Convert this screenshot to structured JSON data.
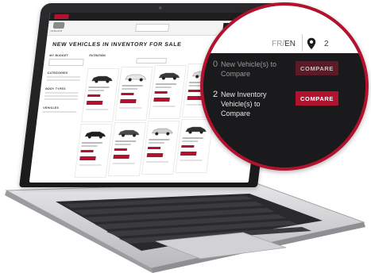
{
  "website": {
    "brand": "JAGUAR",
    "page_title": "NEW VEHICLES IN INVENTORY FOR SALE",
    "sidebar": {
      "budget_label": "MY BUDGET",
      "categories_label": "CATEGORIES",
      "body_types_label": "BODY TYPES",
      "vehicles_label": "VEHICLES"
    },
    "filter_label": "FILTRATION",
    "cards": [
      {
        "name": "2021 JAGUAR F-PACE",
        "price": "$72,970"
      },
      {
        "name": "2021 JAGUAR F-PACE",
        "price": "$67,605"
      },
      {
        "name": "2021 JAGUAR E-PACE",
        "price": "$73,645"
      },
      {
        "name": "2021 JAGUAR F-PACE",
        "price": "$75,695"
      },
      {
        "name": "2021 JAGUAR F-PACE",
        "price": ""
      },
      {
        "name": "2021 JAGUAR I-PACE",
        "price": ""
      },
      {
        "name": "2021 JAGUAR XF",
        "price": ""
      },
      {
        "name": "2021 JAGUAR F-PACE",
        "price": ""
      }
    ]
  },
  "compare_panel": {
    "language": {
      "inactive": "FR",
      "separator": "/",
      "active": "EN"
    },
    "top_count": "2",
    "rows": [
      {
        "count": "0",
        "text": "New Vehicle(s) to Compare",
        "button": "COMPARE"
      },
      {
        "count": "2",
        "text": "New Inventory Vehicle(s) to Compare",
        "button": "COMPARE"
      }
    ]
  },
  "colors": {
    "accent": "#b3122f",
    "dark": "#1a1a1c"
  }
}
